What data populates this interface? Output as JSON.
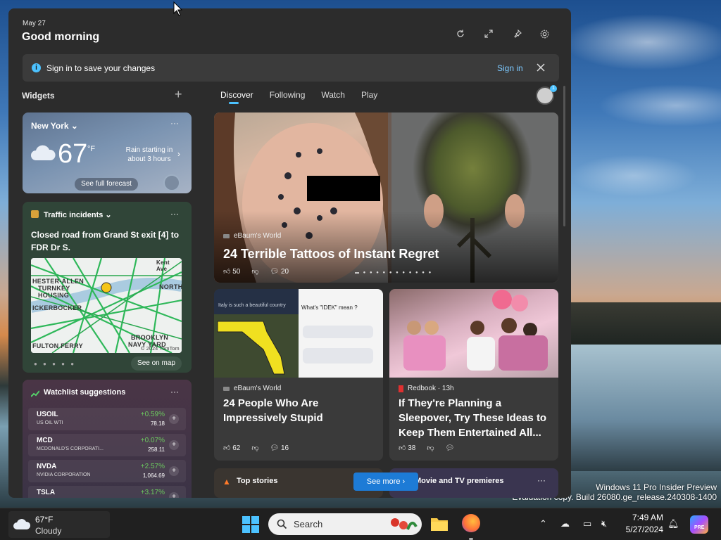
{
  "panel": {
    "date": "May 27",
    "greeting": "Good morning",
    "signin_bar": {
      "message": "Sign in to save your changes",
      "link": "Sign in"
    },
    "widgets_title": "Widgets",
    "add_label": "+",
    "tabs": [
      {
        "label": "Discover",
        "active": true
      },
      {
        "label": "Following"
      },
      {
        "label": "Watch"
      },
      {
        "label": "Play"
      }
    ],
    "avatar_badge": "1"
  },
  "weather": {
    "location": "New York",
    "temp": "67",
    "unit": "°F",
    "condition": "Rain starting in about 3 hours",
    "button": "See full forecast",
    "more": "···"
  },
  "traffic": {
    "title": "Traffic incidents",
    "headline": "Closed road from Grand St exit [4] to FDR Dr S.",
    "map_labels": [
      "HESTER-ALLEN",
      "TURNKEY",
      "HOUSING",
      "ICKERBOCKER",
      "FULTON FERRY",
      "BROOKLYN",
      "NAVY YARD",
      "NORTH",
      "Kent Ave",
      "© 2024 TomTom"
    ],
    "button": "See on map",
    "more": "···"
  },
  "watchlist": {
    "title": "Watchlist suggestions",
    "more": "···",
    "stocks": [
      {
        "symbol": "USOIL",
        "name": "US OIL WTI",
        "change": "+0.59%",
        "price": "78.18"
      },
      {
        "symbol": "MCD",
        "name": "MCDONALD'S CORPORATI...",
        "change": "+0.07%",
        "price": "258.11"
      },
      {
        "symbol": "NVDA",
        "name": "NVIDIA CORPORATION",
        "change": "+2.57%",
        "price": "1,064.69"
      },
      {
        "symbol": "TSLA",
        "name": "",
        "change": "+3.17%",
        "price": ""
      }
    ]
  },
  "hero": {
    "source": "eBaum's World",
    "title": "24 Terrible Tattoos of Instant Regret",
    "likes": "50",
    "comments": "20"
  },
  "news": [
    {
      "source": "eBaum's World",
      "title": "24 People Who Are Impressively Stupid",
      "likes": "62",
      "comments": "16",
      "img_caption": "Italy is such a beautiful country",
      "img_question": "What's \"IDEK\" mean ?"
    },
    {
      "source": "Redbook · 13h",
      "title": "If They're Planning a Sleepover, Try These Ideas to Keep Them Entertained All...",
      "likes": "38",
      "comments": ""
    }
  ],
  "bottom_cards": {
    "top_stories": "Top stories",
    "see_more": "See more",
    "premieres": "Movie and TV premieres",
    "more": "···"
  },
  "watermark": {
    "line1": "Windows 11 Pro Insider Preview",
    "line2": "Evaluation copy. Build 26080.ge_release.240308-1400"
  },
  "taskbar": {
    "weather_temp": "67°F",
    "weather_cond": "Cloudy",
    "search_placeholder": "Search",
    "time": "7:49 AM",
    "date": "5/27/2024",
    "copilot_badge": "PRE"
  }
}
